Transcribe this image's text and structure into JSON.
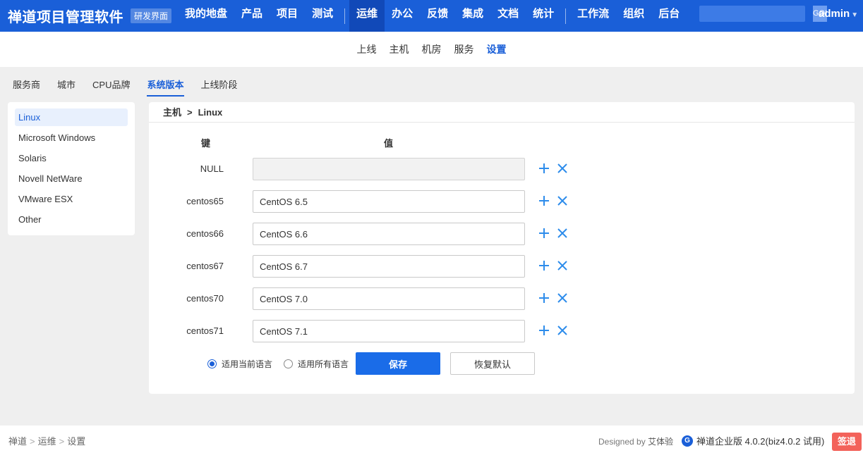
{
  "header": {
    "brand": "禅道项目管理软件",
    "badge": "研发界面",
    "nav_group1": [
      "我的地盘",
      "产品",
      "项目",
      "测试"
    ],
    "nav_group2": [
      "运维",
      "办公",
      "反馈",
      "集成",
      "文档",
      "统计"
    ],
    "nav_group3": [
      "工作流",
      "组织",
      "后台"
    ],
    "active_nav": "运维",
    "search_placeholder": "",
    "search_button": "GO!",
    "user": "admin"
  },
  "subnav": {
    "items": [
      "上线",
      "主机",
      "机房",
      "服务",
      "设置"
    ],
    "active": "设置"
  },
  "tabs": {
    "items": [
      "服务商",
      "城市",
      "CPU品牌",
      "系统版本",
      "上线阶段"
    ],
    "active": "系统版本"
  },
  "sidebar": {
    "items": [
      "Linux",
      "Microsoft Windows",
      "Solaris",
      "Novell NetWare",
      "VMware ESX",
      "Other"
    ],
    "active": "Linux"
  },
  "panel": {
    "breadcrumb_parent": "主机",
    "breadcrumb_sep": ">",
    "breadcrumb_current": "Linux",
    "col_key": "键",
    "col_value": "值",
    "rows": [
      {
        "key": "NULL",
        "value": "",
        "disabled": true
      },
      {
        "key": "centos65",
        "value": "CentOS 6.5",
        "disabled": false
      },
      {
        "key": "centos66",
        "value": "CentOS 6.6",
        "disabled": false
      },
      {
        "key": "centos67",
        "value": "CentOS 6.7",
        "disabled": false
      },
      {
        "key": "centos70",
        "value": "CentOS 7.0",
        "disabled": false
      },
      {
        "key": "centos71",
        "value": "CentOS 7.1",
        "disabled": false
      }
    ],
    "radio_current": "适用当前语言",
    "radio_all": "适用所有语言",
    "radio_selected": "current",
    "save_label": "保存",
    "reset_label": "恢复默认"
  },
  "footer": {
    "crumbs": [
      "禅道",
      "运维",
      "设置"
    ],
    "designed_by_prefix": "Designed by",
    "designed_by_name": "艾体验",
    "version": "禅道企业版 4.0.2(biz4.0.2 试用)",
    "signout": "签退"
  },
  "colors": {
    "primary": "#1a5fd8",
    "icon_blue": "#2d8ceb",
    "signout_red": "#f3625a"
  }
}
